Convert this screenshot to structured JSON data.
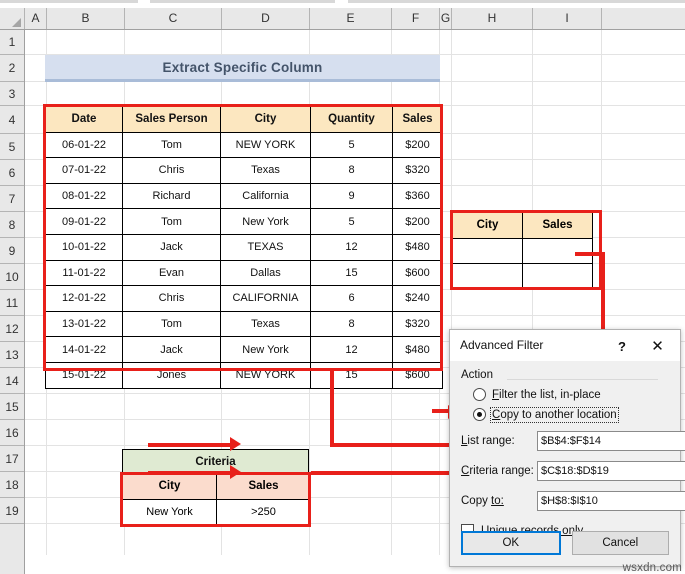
{
  "sheet": {
    "columns": [
      "A",
      "B",
      "C",
      "D",
      "E",
      "F",
      "G",
      "H",
      "I"
    ],
    "rows": [
      "1",
      "2",
      "3",
      "4",
      "5",
      "6",
      "7",
      "8",
      "9",
      "10",
      "11",
      "12",
      "13",
      "14",
      "15",
      "16",
      "17",
      "18",
      "19"
    ]
  },
  "title_banner": {
    "text": "Extract Specific Column",
    "bg": "#d6dfef",
    "fg": "#44546a"
  },
  "main_table": {
    "headers": [
      "Date",
      "Sales Person",
      "City",
      "Quantity",
      "Sales"
    ],
    "header_bg": "#fce7c0",
    "rows": [
      [
        "06-01-22",
        "Tom",
        "NEW YORK",
        "5",
        "$200"
      ],
      [
        "07-01-22",
        "Chris",
        "Texas",
        "8",
        "$320"
      ],
      [
        "08-01-22",
        "Richard",
        "California",
        "9",
        "$360"
      ],
      [
        "09-01-22",
        "Tom",
        "New York",
        "5",
        "$200"
      ],
      [
        "10-01-22",
        "Jack",
        "TEXAS",
        "12",
        "$480"
      ],
      [
        "11-01-22",
        "Evan",
        "Dallas",
        "15",
        "$600"
      ],
      [
        "12-01-22",
        "Chris",
        "CALIFORNIA",
        "6",
        "$240"
      ],
      [
        "13-01-22",
        "Tom",
        "Texas",
        "8",
        "$320"
      ],
      [
        "14-01-22",
        "Jack",
        "New York",
        "12",
        "$480"
      ],
      [
        "15-01-22",
        "Jones",
        "NEW YORK",
        "15",
        "$600"
      ]
    ]
  },
  "output_table": {
    "headers": [
      "City",
      "Sales"
    ],
    "header_bg": "#fce7c0",
    "rows": [
      [
        "",
        ""
      ],
      [
        "",
        ""
      ]
    ]
  },
  "criteria_block": {
    "title": "Criteria",
    "title_bg": "#dfead2",
    "headers": [
      "City",
      "Sales"
    ],
    "header_bg": "#fbdccd",
    "rows": [
      [
        "New York",
        ">250"
      ]
    ]
  },
  "dialog": {
    "title": "Advanced Filter",
    "help_icon": "?",
    "close_icon": "✕",
    "action_group_label": "Action",
    "radio_in_place": {
      "label_pre": "F",
      "label_post": "ilter the list, in-place",
      "selected": false
    },
    "radio_copy": {
      "label_pre": "C",
      "label_post": "opy to another location",
      "selected": true
    },
    "fields": [
      {
        "label_pre": "L",
        "label_post": "ist range:",
        "value": "$B$4:$F$14",
        "picker_icon": "↑"
      },
      {
        "label_pre": "C",
        "label_post": "riteria range:",
        "value": "$C$18:$D$19",
        "picker_icon": "↑"
      },
      {
        "label_pre": "Copy ",
        "label_post": "to:",
        "value": "$H$8:$I$10",
        "picker_icon": "↑"
      }
    ],
    "checkbox": {
      "label_pre": "Unique r",
      "label_post": "ecords only",
      "checked": false
    },
    "ok_button": "OK",
    "cancel_button": "Cancel",
    "focus_color": "#0078d7"
  },
  "annotation": {
    "color": "#e8201a"
  },
  "watermark": {
    "text": "wsxdn.com"
  }
}
